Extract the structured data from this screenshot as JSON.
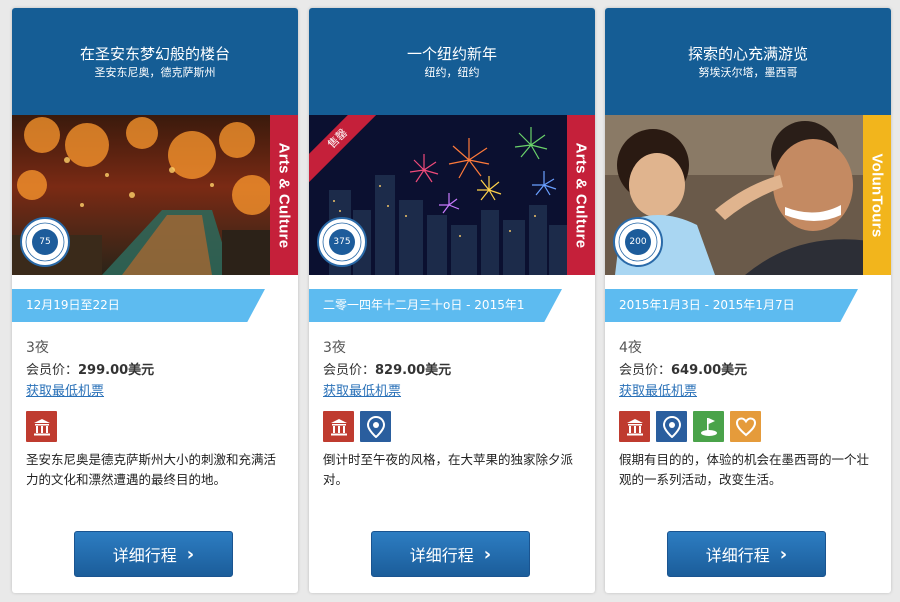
{
  "cards": [
    {
      "title": "在圣安东梦幻般的楼台",
      "subtitle": "圣安东尼奥，德克萨斯州",
      "category": "Arts & Culture",
      "points": "75",
      "corner_tag": "",
      "dates": "12月19日至22日",
      "nights": "3夜",
      "price_label": "会员价：",
      "price_value": "299.00美元",
      "flights_link": "获取最低机票",
      "icons": [
        "museum-icon"
      ],
      "description": "圣安东尼奥是德克萨斯州大小的刺激和充满活力的文化和漂然遭遇的最终目的地。",
      "button_label": "详细行程"
    },
    {
      "title": "一个纽约新年",
      "subtitle": "纽约，纽约",
      "category": "Arts & Culture",
      "points": "375",
      "corner_tag": "售罄",
      "dates": "二零一四年十二月三十o日 - 2015年1",
      "nights": "3夜",
      "price_label": "会员价：",
      "price_value": "829.00美元",
      "flights_link": "获取最低机票",
      "icons": [
        "museum-icon",
        "location-pin-icon"
      ],
      "description": "倒计时至午夜的风格，在大苹果的独家除夕派对。",
      "button_label": "详细行程"
    },
    {
      "title": "探索的心充满游览",
      "subtitle": "努埃沃尔塔，墨西哥",
      "category": "VolunTours",
      "points": "200",
      "corner_tag": "",
      "dates": "2015年1月3日 - 2015年1月7日",
      "nights": "4夜",
      "price_label": "会员价：",
      "price_value": "649.00美元",
      "flights_link": "获取最低机票",
      "icons": [
        "museum-icon",
        "location-pin-icon",
        "golf-icon",
        "heart-icon"
      ],
      "description": "假期有目的的，体验的机会在墨西哥的一个壮观的一系列活动，改变生活。",
      "button_label": "详细行程"
    }
  ],
  "badge_text": "APPLY UP TO POINTS",
  "colors": {
    "header": "#155d95",
    "date_bar": "#5dbbf0",
    "category_red": "#c5203a",
    "category_yellow": "#f2b51c",
    "button": "#2366a8",
    "link": "#2a71b8"
  }
}
